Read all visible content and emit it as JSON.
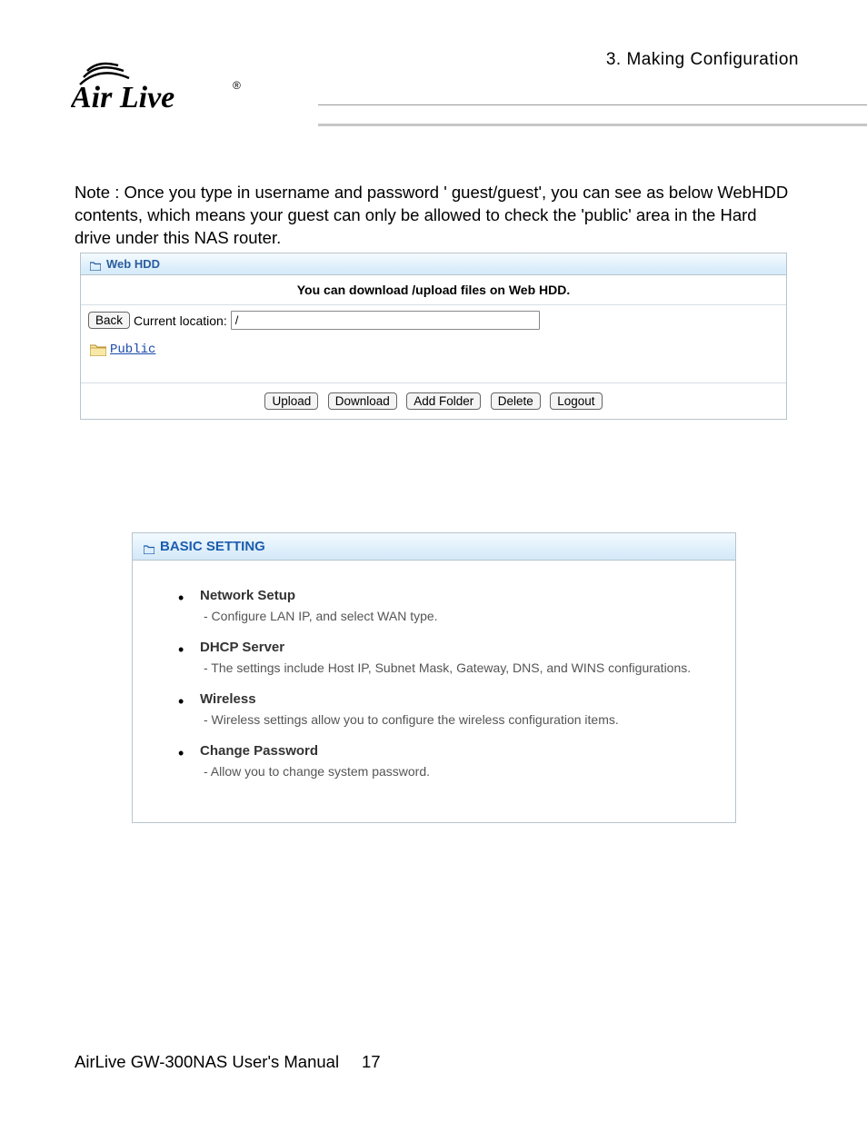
{
  "header": {
    "chapter": "3. Making Configuration",
    "logo_alt": "Air Live"
  },
  "note": "Note : Once you type in username and password ' guest/guest', you can see as below WebHDD contents, which means your guest can only be allowed to check the 'public' area in the Hard drive under this NAS router.",
  "webhdd": {
    "title": "Web HDD",
    "message": "You can download /upload files on Web HDD.",
    "back": "Back",
    "location_label": "Current location:",
    "location_value": "/",
    "folder_name": "Public",
    "buttons": {
      "upload": "Upload",
      "download": "Download",
      "add_folder": "Add Folder",
      "delete": "Delete",
      "logout": "Logout"
    }
  },
  "basic": {
    "title": "BASIC SETTING",
    "items": [
      {
        "title": "Network Setup",
        "desc": "- Configure LAN IP, and select WAN type."
      },
      {
        "title": "DHCP Server",
        "desc": "- The settings include Host IP, Subnet Mask, Gateway, DNS, and WINS configurations."
      },
      {
        "title": "Wireless",
        "desc": "- Wireless settings allow you to configure the wireless configuration items."
      },
      {
        "title": "Change Password",
        "desc": "- Allow you to change system password."
      }
    ]
  },
  "footer": {
    "manual": "AirLive GW-300NAS User's Manual",
    "page": "17"
  }
}
